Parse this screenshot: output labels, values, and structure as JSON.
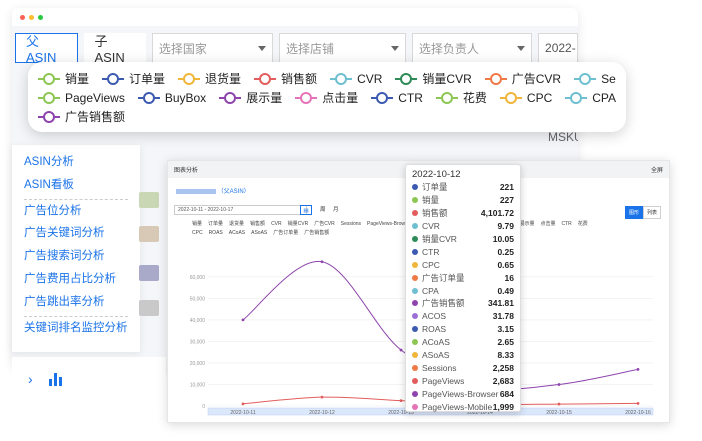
{
  "window": {
    "dots": [
      "#ff5f57",
      "#febc2e",
      "#28c840"
    ]
  },
  "filters": {
    "tab_parent": "父ASIN",
    "tab_child": "子ASIN",
    "country_placeholder": "选择国家",
    "store_placeholder": "选择店铺",
    "owner_placeholder": "选择负责人",
    "date_partial": "2022-"
  },
  "background": {
    "msku": "MSKU"
  },
  "legend": {
    "rows": [
      [
        {
          "label": "销量",
          "color": "#8dc653"
        },
        {
          "label": "订单量",
          "color": "#3c5ab0"
        },
        {
          "label": "退货量",
          "color": "#f0b63a"
        },
        {
          "label": "销售额",
          "color": "#e35d5d"
        },
        {
          "label": "CVR",
          "color": "#6ebfd0"
        },
        {
          "label": "销量CVR",
          "color": "#2e8a57"
        },
        {
          "label": "广告CVR",
          "color": "#ef7a45"
        },
        {
          "label": "Sess",
          "color": "#6ebfd0"
        }
      ],
      [
        {
          "label": "PageViews",
          "color": "#8dc653"
        },
        {
          "label": "BuyBox",
          "color": "#3c5ab0"
        },
        {
          "label": "展示量",
          "color": "#8e44ad"
        },
        {
          "label": "点击量",
          "color": "#e573b8"
        },
        {
          "label": "CTR",
          "color": "#3c5ab0"
        },
        {
          "label": "花费",
          "color": "#8dc653"
        },
        {
          "label": "CPC",
          "color": "#f0b63a"
        },
        {
          "label": "CPA",
          "color": "#6ebfd0"
        }
      ],
      [
        {
          "label": "广告销售额",
          "color": "#8e44ad"
        }
      ]
    ]
  },
  "sidebar": {
    "items": [
      {
        "label": "ASIN分析"
      },
      {
        "label": "ASIN看板"
      },
      {
        "label": "广告位分析"
      },
      {
        "label": "广告关键词分析"
      },
      {
        "label": "广告搜索词分析"
      },
      {
        "label": "广告费用占比分析"
      },
      {
        "label": "广告跳出率分析"
      },
      {
        "label": "关键词排名监控分析"
      }
    ]
  },
  "chart_window": {
    "title": "图表分析",
    "fullscreen": "全屏",
    "subtitle": "（父ASIN）",
    "date_range": "2022-10-11 - 2022-10-17",
    "period_week": "周",
    "period_month": "月",
    "toggle_chart": "图形",
    "toggle_list": "列表",
    "mini_legend": [
      "销量",
      "订单量",
      "退货量",
      "销售额",
      "CVR",
      "销量CVR",
      "广告CVR",
      "Sessions",
      "PageViews-Browser",
      "PageViews-Mobile",
      "PageViews",
      "BuyBox",
      "展示量",
      "点击量",
      "CTR",
      "花费",
      "CPC",
      "ROAS",
      "ACoAS",
      "ASoAS",
      "广告订单量",
      "广告销售额"
    ]
  },
  "chart_data": {
    "type": "line",
    "x": [
      "2022-10-11",
      "2022-10-12",
      "2022-10-13",
      "2022-10-14",
      "2022-10-15",
      "2022-10-16"
    ],
    "y_ticks": [
      0,
      10000,
      20000,
      30000,
      40000,
      50000,
      60000
    ],
    "y_tick_labels": [
      "0",
      "10,000",
      "20,000",
      "30,000",
      "40,000",
      "50,000",
      "60,000"
    ],
    "ylim": [
      0,
      72000
    ],
    "grid": true,
    "legend_placement": "top",
    "series": [
      {
        "color": "#8e44ad",
        "values": [
          40000,
          67000,
          26000,
          9000,
          10000,
          17000
        ]
      },
      {
        "color": "#e35d5d",
        "values": [
          1000,
          4101.72,
          2500,
          800,
          900,
          1200
        ]
      }
    ]
  },
  "tooltip": {
    "date": "2022-10-12",
    "rows": [
      {
        "name": "订单量",
        "value": "221",
        "color": "#3c5ab0"
      },
      {
        "name": "销量",
        "value": "227",
        "color": "#8dc653"
      },
      {
        "name": "销售额",
        "value": "4,101.72",
        "color": "#e35d5d"
      },
      {
        "name": "CVR",
        "value": "9.79",
        "color": "#6ebfd0"
      },
      {
        "name": "销量CVR",
        "value": "10.05",
        "color": "#2e8a57"
      },
      {
        "name": "CTR",
        "value": "0.25",
        "color": "#3c5ab0"
      },
      {
        "name": "CPC",
        "value": "0.65",
        "color": "#f0b63a"
      },
      {
        "name": "广告订单量",
        "value": "16",
        "color": "#ef7a45"
      },
      {
        "name": "CPA",
        "value": "0.49",
        "color": "#6ebfd0"
      },
      {
        "name": "广告销售额",
        "value": "341.81",
        "color": "#8e44ad"
      },
      {
        "name": "ACOS",
        "value": "31.78",
        "color": "#9b6fd6"
      },
      {
        "name": "ROAS",
        "value": "3.15",
        "color": "#3c5ab0"
      },
      {
        "name": "ACoAS",
        "value": "2.65",
        "color": "#8dc653"
      },
      {
        "name": "ASoAS",
        "value": "8.33",
        "color": "#f0b63a"
      },
      {
        "name": "Sessions",
        "value": "2,258",
        "color": "#ef7a45"
      },
      {
        "name": "PageViews",
        "value": "2,683",
        "color": "#e35d5d"
      },
      {
        "name": "PageViews-Browser",
        "value": "684",
        "color": "#8e44ad"
      },
      {
        "name": "PageViews-Mobile",
        "value": "1,999",
        "color": "#e573b8"
      }
    ]
  }
}
